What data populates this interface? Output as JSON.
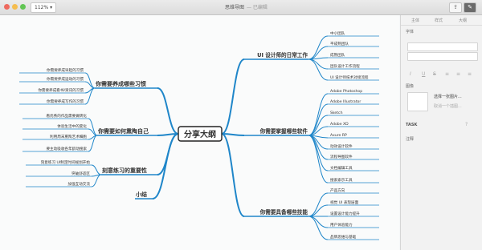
{
  "toolbar": {
    "zoom": "112%",
    "title": "思维导图",
    "subtitle": "— 已编辑"
  },
  "root": {
    "label": "分享大纲"
  },
  "left_topics": [
    {
      "label": "你需要养成哪些习惯",
      "children": [
        "你需要养成早起的习惯",
        "你需要养成运动的习惯",
        "你需要养成看书/资讯的习惯",
        "你需要养成写作的习惯"
      ]
    },
    {
      "label": "你需要如何熏陶自己",
      "children": [
        "看优秀的作品需要做转化",
        "体验生活中的变化",
        "利用周末熏陶艺术细胞",
        "要主动吸收各年龄动搜索"
      ]
    },
    {
      "label": "刻意练习的重要性",
      "children": [
        "刻意练习 UI制定时间规划开始",
        "突破舒适区",
        "加强互动交流"
      ]
    },
    {
      "label": "小结",
      "children": []
    }
  ],
  "right_topics": [
    {
      "label": "UI 设计师的日常工作",
      "children": [
        "中小团队",
        "平成熟团队",
        "成熟团队",
        "团队设计工作流程",
        "UI 设计师技术对接流程"
      ]
    },
    {
      "label": "你需要掌握哪些软件",
      "children": [
        "Adobe Photoshop",
        "Adobe Illustrator",
        "Sketch",
        "Adobe XD",
        "Axure RP",
        "动效设计软件",
        "流程导图软件",
        "文档编辑工具",
        "搜索索示工具"
      ]
    },
    {
      "label": "你需要具备哪些技能",
      "children": [
        "产品方向",
        "视觉 UI 表现层面",
        "设置设计能力提升",
        "用户体验能力",
        "品牌思维与基础"
      ]
    }
  ],
  "panel": {
    "tabs": [
      "主体",
      "样式",
      "大纲"
    ],
    "font_label": "字体",
    "image_label": "图像",
    "image_select": "选择一张图片...",
    "image_hint": "取消一个插图...",
    "task_label": "TASK",
    "note_label": "注释"
  },
  "colors": {
    "branch": "#1f86c9",
    "root_border": "#222222",
    "text": "#333333"
  }
}
